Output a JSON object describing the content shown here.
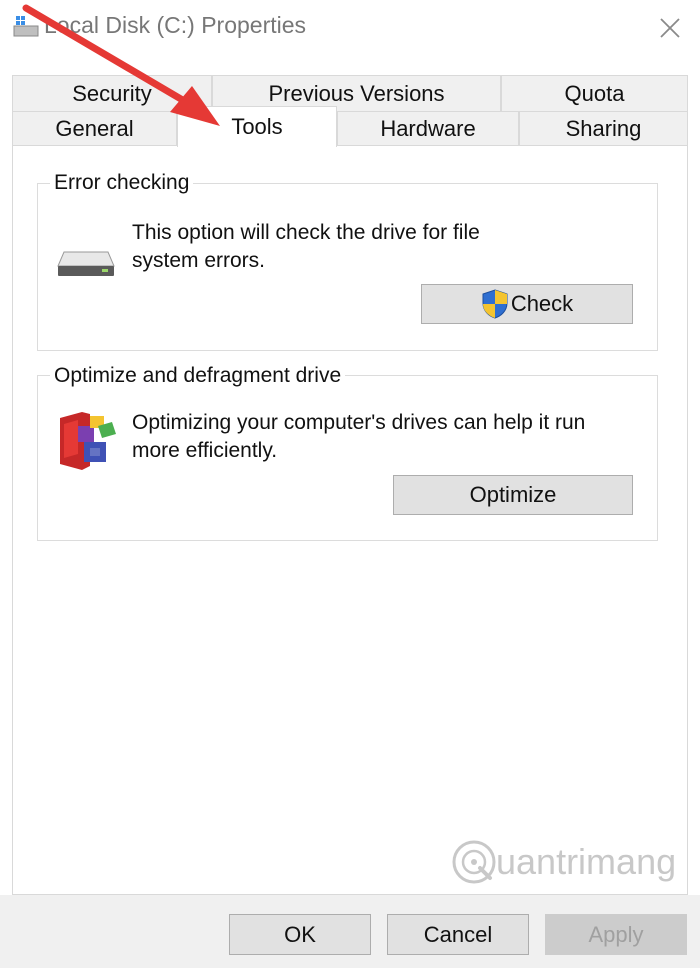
{
  "window": {
    "title": "Local Disk (C:) Properties",
    "close_icon": "close-icon"
  },
  "tabs": {
    "row1": [
      "Security",
      "Previous Versions",
      "Quota"
    ],
    "row2": [
      "General",
      "Tools",
      "Hardware",
      "Sharing"
    ],
    "active": "Tools"
  },
  "error_checking": {
    "title": "Error checking",
    "description_line1": "This option will check the drive for file",
    "description_line2": "system errors.",
    "button": "Check",
    "icon": "drive-icon",
    "button_icon": "shield-icon"
  },
  "optimize": {
    "title": "Optimize and defragment drive",
    "description_line1": "Optimizing your computer's drives can help it run",
    "description_line2": "more efficiently.",
    "button": "Optimize",
    "icon": "defrag-icon"
  },
  "footer": {
    "ok": "OK",
    "cancel": "Cancel",
    "apply": "Apply"
  },
  "watermark": {
    "text": "uantrimang",
    "logo_letter": "Q"
  },
  "colors": {
    "annotation_arrow": "#e53935",
    "tab_background": "#f0f0f0",
    "button_background": "#e1e1e1",
    "disabled_text": "#a0a0a0"
  }
}
